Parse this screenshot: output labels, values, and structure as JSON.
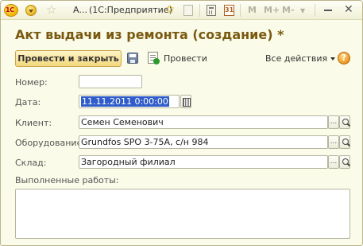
{
  "window": {
    "title_short": "А...",
    "app_name": "(1С:Предприятие)",
    "logo_text": "1С",
    "toolbar_m_buttons": [
      "M",
      "M+",
      "M-"
    ],
    "calendar_day": "31"
  },
  "form": {
    "heading": "Акт выдачи из ремонта (создание) *",
    "commands": {
      "post_and_close": "Провести и закрыть",
      "post": "Провести",
      "all_actions": "Все действия",
      "help": "?"
    },
    "fields": {
      "number": {
        "label": "Номер:",
        "value": ""
      },
      "date": {
        "label": "Дата:",
        "value": "11.11.2011  0:00:00"
      },
      "client": {
        "label": "Клиент:",
        "value": "Семен Семенович"
      },
      "equipment": {
        "label": "Оборудование:",
        "value": "Grundfos SPO 3-75A, с/н 984"
      },
      "warehouse": {
        "label": "Склад:",
        "value": "Загородный филиал"
      }
    },
    "works": {
      "label": "Выполненные работы:",
      "value": ""
    },
    "select_button": "...",
    "accent_color": "#7a5a10",
    "button_color": "#f2d77c"
  }
}
